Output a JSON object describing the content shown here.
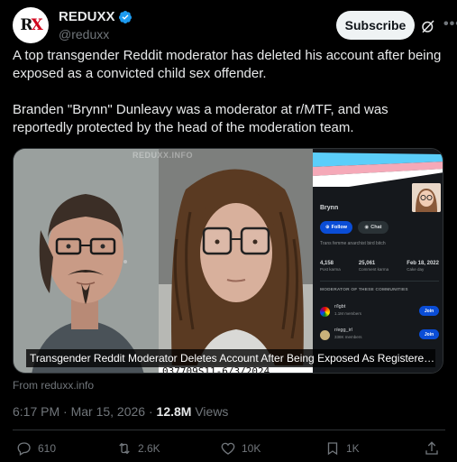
{
  "header": {
    "display_name": "REDUXX",
    "handle": "@reduxx",
    "subscribe_label": "Subscribe",
    "avatar_logo_r": "R",
    "avatar_logo_x": "X"
  },
  "tweet": {
    "text": "A top transgender Reddit moderator has deleted his account after being exposed as a convicted child sex offender.\n\nBranden \"Brynn\" Dunleavy was a moderator at r/MTF, and was reportedly protected by the head of the moderation team."
  },
  "media": {
    "watermark": "REDUXX.INFO",
    "mugshot_id": "037709S11-6/3/2024",
    "caption": "Transgender Reddit Moderator Deletes Account After Being Exposed As Registered Ch…",
    "reddit_profile": {
      "name": "Brynn",
      "follow_label": "Follow",
      "chat_label": "Chat",
      "bio": "Trans femme anarchist bird bitch",
      "stats": [
        {
          "value": "4,158",
          "label": "Post karma"
        },
        {
          "value": "25,061",
          "label": "Comment karma"
        },
        {
          "value": "Feb 18, 2022",
          "label": "Cake day"
        }
      ],
      "moderator_title": "MODERATOR OF THESE COMMUNITIES",
      "communities": [
        {
          "name": "r/lgbt",
          "members": "1.1M members",
          "join_label": "Join"
        },
        {
          "name": "r/egg_irl",
          "members": "338K members",
          "join_label": "Join"
        }
      ]
    }
  },
  "source": "From reduxx.info",
  "meta": {
    "timestamp": "6:17 PM · Mar 15, 2026 · ",
    "views_count": "12.8M",
    "views_label": " Views"
  },
  "actions": {
    "replies": "610",
    "reposts": "2.6K",
    "likes": "10K",
    "bookmarks": "1K"
  },
  "colors": {
    "background": "#000000",
    "text": "#e7e9ea",
    "muted": "#71767b",
    "verified": "#1d9bf0",
    "reddit_blue": "#0a4dd6"
  }
}
